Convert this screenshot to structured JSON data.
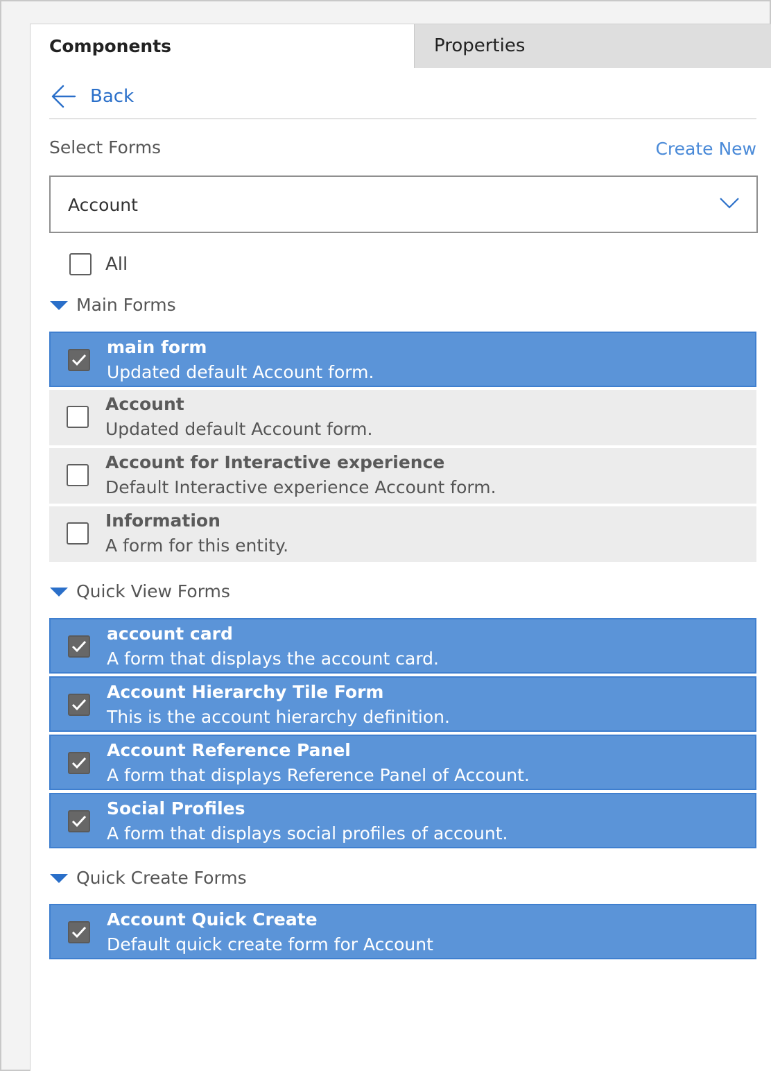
{
  "tabs": {
    "components": "Components",
    "properties": "Properties"
  },
  "back_label": "Back",
  "select_forms_label": "Select Forms",
  "create_new_label": "Create New",
  "dropdown": {
    "value": "Account"
  },
  "all_label": "All",
  "all_checked": false,
  "colors": {
    "accent": "#2a6fc9",
    "selected_row": "#5b94d8",
    "unselected_row": "#ececec"
  },
  "sections": [
    {
      "title": "Main Forms",
      "items": [
        {
          "title": "main form",
          "desc": "Updated default Account form.",
          "checked": true
        },
        {
          "title": "Account",
          "desc": "Updated default Account form.",
          "checked": false
        },
        {
          "title": "Account for Interactive experience",
          "desc": "Default Interactive experience Account form.",
          "checked": false
        },
        {
          "title": "Information",
          "desc": "A form for this entity.",
          "checked": false
        }
      ]
    },
    {
      "title": "Quick View Forms",
      "items": [
        {
          "title": "account card",
          "desc": "A form that displays the account card.",
          "checked": true
        },
        {
          "title": "Account Hierarchy Tile Form",
          "desc": "This is the account hierarchy definition.",
          "checked": true
        },
        {
          "title": "Account Reference Panel",
          "desc": "A form that displays Reference Panel of Account.",
          "checked": true
        },
        {
          "title": "Social Profiles",
          "desc": "A form that displays social profiles of account.",
          "checked": true
        }
      ]
    },
    {
      "title": "Quick Create Forms",
      "items": [
        {
          "title": "Account Quick Create",
          "desc": "Default quick create form for Account",
          "checked": true
        }
      ]
    }
  ]
}
